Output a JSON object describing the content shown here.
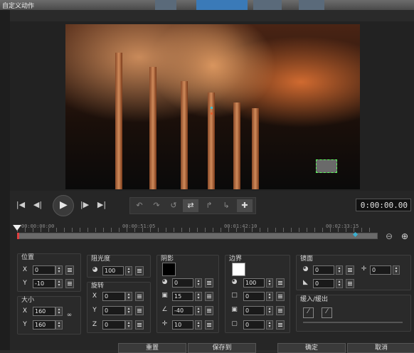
{
  "window": {
    "title": "自定义动作"
  },
  "playback": {
    "timecode": "0:00:00.00",
    "buttons": [
      "go-to-start",
      "previous-frame",
      "play",
      "next-frame",
      "go-to-end"
    ]
  },
  "timeline": {
    "ticks": [
      "00:00:00:00",
      "00:00:51:05",
      "00:01:42:10",
      "00:02:33:15"
    ]
  },
  "position": {
    "label": "位置",
    "x": "0",
    "y": "-10"
  },
  "size": {
    "label": "大小",
    "x": "160",
    "y": "160"
  },
  "opacity": {
    "label": "阻光度",
    "value": "100"
  },
  "rotation": {
    "label": "旋转",
    "x": "0",
    "y": "0",
    "z": "0"
  },
  "shadow": {
    "label": "阴影",
    "color": "#000000",
    "opacity": "0",
    "blur": "15",
    "angle": "-40",
    "distance": "10"
  },
  "border": {
    "label": "边界",
    "color": "#ffffff",
    "opacity": "100",
    "width": "0",
    "field3": "0",
    "field4": "0"
  },
  "mirror": {
    "label": "镜面",
    "v1": "0",
    "v2": "0",
    "v3": "0"
  },
  "fade": {
    "label": "缓入/缓出"
  },
  "footer": {
    "reset": "重置",
    "save_as": "保存到",
    "ok": "确定",
    "cancel": "取消"
  }
}
